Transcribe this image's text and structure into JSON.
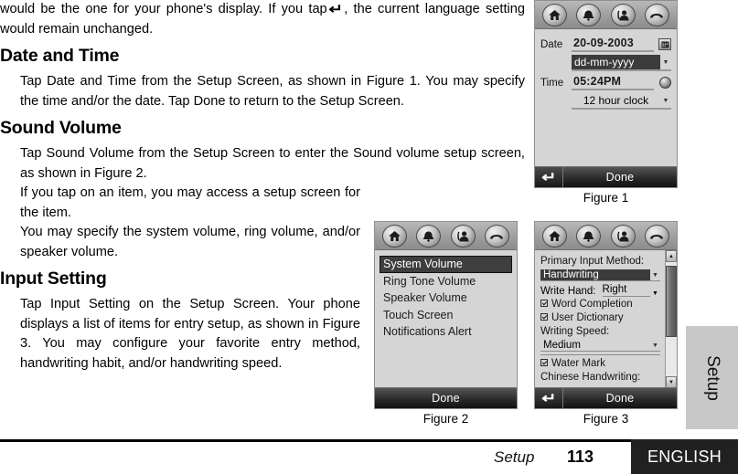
{
  "body_text": {
    "continued_paragraph": "would be the one for your phone's display. If you tap",
    "continued_paragraph_tail": ", the current language setting would remain unchanged.",
    "enter_icon_glyph": "↵",
    "sections": [
      {
        "heading": "Date and Time",
        "paragraphs": [
          "Tap Date and Time from the Setup Screen, as shown in Figure 1. You may specify the time and/or the date. Tap Done to return to the Setup Screen."
        ]
      },
      {
        "heading": "Sound Volume",
        "paragraphs": [
          "Tap Sound Volume from the Setup Screen to enter the Sound volume setup screen, as shown in Figure 2.",
          "If you tap on an item, you may access a setup screen for the item.",
          "You may specify the system volume, ring volume, and/or speaker volume."
        ]
      },
      {
        "heading": "Input Setting",
        "paragraphs": [
          "Tap Input Setting on the Setup Screen. Your phone displays a list of items for entry setup, as shown in Figure 3. You may configure your favorite entry method, handwriting habit, and/or handwriting speed."
        ]
      }
    ]
  },
  "toolbar_icons": [
    {
      "name": "home-icon",
      "label": "Home"
    },
    {
      "name": "alarm-bell-icon",
      "label": "Alarm"
    },
    {
      "name": "contact-help-icon",
      "label": "Contacts"
    },
    {
      "name": "end-call-icon",
      "label": "End Call"
    }
  ],
  "figure1": {
    "caption": "Figure 1",
    "date_label": "Date",
    "date_value": "20-09-2003",
    "date_picker_icon": "calendar-icon",
    "date_format_value": "dd-mm-yyyy",
    "time_label": "Time",
    "time_value": "05:24PM",
    "time_picker_icon": "clock-icon",
    "clock_format_value": "12 hour clock",
    "done_label": "Done",
    "enter_glyph": "↵",
    "caret_glyph": "▼"
  },
  "figure2": {
    "caption": "Figure 2",
    "items": [
      {
        "label": "System Volume",
        "selected": true
      },
      {
        "label": "Ring Tone Volume",
        "selected": false
      },
      {
        "label": "Speaker Volume",
        "selected": false
      },
      {
        "label": "Touch Screen",
        "selected": false
      },
      {
        "label": "Notifications Alert",
        "selected": false
      }
    ],
    "done_label": "Done"
  },
  "figure3": {
    "caption": "Figure 3",
    "primary_input_label": "Primary Input Method:",
    "primary_input_value": "Handwriting",
    "write_hand_label": "Write Hand:",
    "write_hand_value": "Right",
    "word_completion_label": "Word Completion",
    "user_dictionary_label": "User Dictionary",
    "writing_speed_label": "Writing Speed:",
    "writing_speed_value": "Medium",
    "water_mark_label": "Water Mark",
    "chinese_handwriting_label": "Chinese Handwriting:",
    "done_label": "Done",
    "enter_glyph": "↵",
    "caret_glyph": "▼",
    "scroll_up_glyph": "▲",
    "scroll_down_glyph": "▼"
  },
  "side_tab": {
    "label": "Setup"
  },
  "footer": {
    "section_label": "Setup",
    "page_number": "113",
    "language": "ENGLISH"
  }
}
